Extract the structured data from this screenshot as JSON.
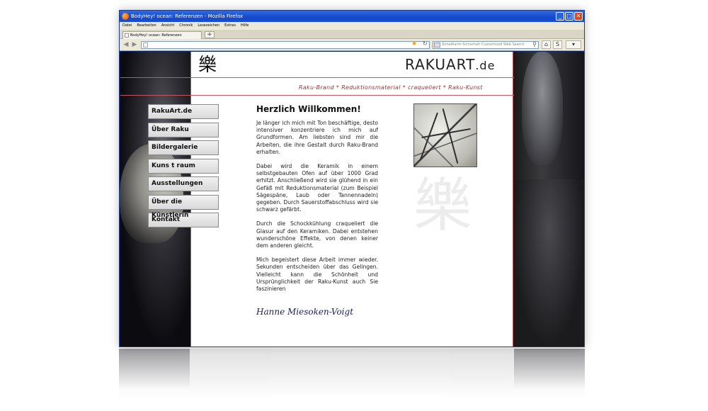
{
  "window": {
    "title": "BodyHey! ocean: Referenzen - Mozilla Firefox",
    "controls": [
      "minimize",
      "maximize",
      "close"
    ]
  },
  "menubar": {
    "items": [
      "Datei",
      "Bearbeiten",
      "Ansicht",
      "Chronik",
      "Lesezeichen",
      "Extras",
      "Hilfe"
    ]
  },
  "tabs": [
    {
      "label": "BodyHey! ocean: Referenzen"
    }
  ],
  "newtab_label": "+",
  "navbar": {
    "url": "",
    "search_placeholder": "ZoneAlarm-Sicherheit Customized Web Search"
  },
  "site": {
    "logo_kanji": "樂",
    "brand": "RAKUART",
    "brand_tld": ".de",
    "tagline": [
      "Raku-Brand",
      "Reduktionsmaterial",
      "craqueliert",
      "Raku-Kunst"
    ],
    "tagline_separator": "*",
    "nav": [
      "RakuArt.de",
      "Über Raku",
      "Bildergalerie",
      "Kuns t raum",
      "Ausstellungen",
      "Über die Künstlerin",
      "Kontakt"
    ],
    "heading": "Herzlich Willkommen!",
    "paragraphs": [
      "Je länger ich mich mit Ton beschäftige, desto intensiver konzentriere ich mich auf Grundformen. Am liebsten sind mir die Arbeiten, die ihre Gestalt durch Raku-Brand erhalten.",
      "Dabei wird die Keramik in einem selbstgebauten Ofen auf über 1000 Grad erhitzt. Anschließend wird sie glühend in ein Gefäß mit Reduktionsmaterial (zum Beispiel Sägespäne, Laub oder Tannennadeln) gegeben. Durch Sauerstoffabschluss wird sie schwarz gefärbt.",
      "Durch die Schockkühlung craqueliert die Glasur auf den Keramiken. Dabei entstehen wunderschöne Effekte, von denen keiner dem anderen gleicht.",
      "Mich begeistert diese Arbeit immer wieder. Sekunden entscheiden über das Gelingen. Vielleicht kann die Schönheit und Ursprünglichkeit der Raku-Kunst auch Sie faszinieren"
    ],
    "signature": "Hanne Miesoken-Voigt",
    "watermark_kanji": "樂"
  },
  "colors": {
    "accent_red": "#c2565a",
    "tagline_red": "#a2323a",
    "titlebar_blue": "#1648c8"
  },
  "icons": {
    "back": "back-arrow-icon",
    "forward": "forward-arrow-icon",
    "bookmark": "star-icon",
    "reload": "reload-icon",
    "search": "magnifier-icon",
    "home": "home-icon"
  }
}
